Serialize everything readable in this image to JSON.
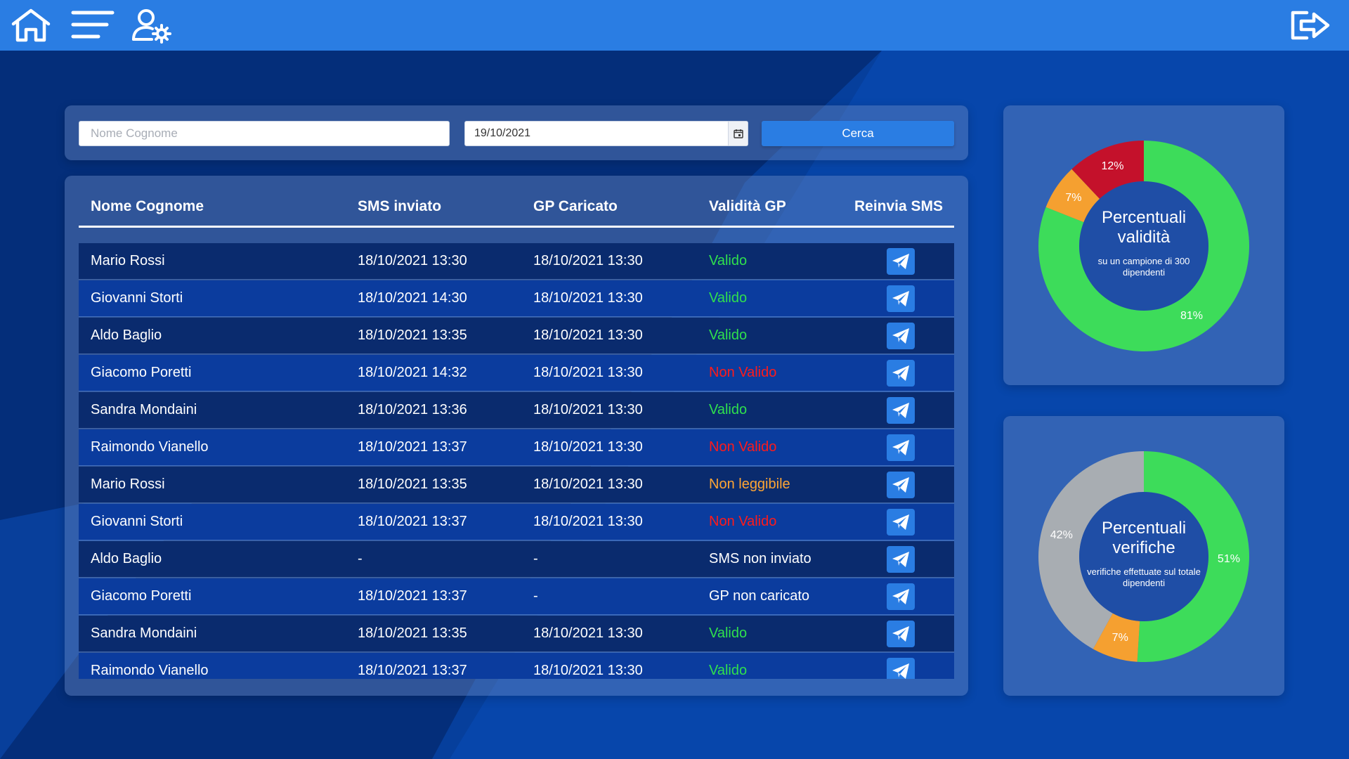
{
  "colors": {
    "topbar": "#2a7de3",
    "valid": "#2fe04d",
    "invalid": "#ff1a1a",
    "unreadable": "#ffa534",
    "chart_green": "#3ddc5a",
    "chart_orange": "#f5a030",
    "chart_red": "#c4112b",
    "chart_gray": "#a8adb2",
    "chart_inner": "#1f4ea6"
  },
  "topbar": {
    "icons": [
      "home-icon",
      "menu-icon",
      "user-settings-icon",
      "logout-icon"
    ]
  },
  "search": {
    "name_placeholder": "Nome Cognome",
    "name_value": "",
    "date_value": "19/10/2021",
    "button_label": "Cerca"
  },
  "table": {
    "headers": {
      "name": "Nome Cognome",
      "sms": "SMS inviato",
      "gp": "GP Caricato",
      "validity": "Validità GP",
      "resend": "Reinvia SMS"
    },
    "rows": [
      {
        "name": "Mario Rossi",
        "sms": "18/10/2021 13:30",
        "gp": "18/10/2021 13:30",
        "validity": "Valido",
        "status": "valid"
      },
      {
        "name": "Giovanni Storti",
        "sms": "18/10/2021 14:30",
        "gp": "18/10/2021 13:30",
        "validity": "Valido",
        "status": "valid"
      },
      {
        "name": "Aldo Baglio",
        "sms": "18/10/2021 13:35",
        "gp": "18/10/2021 13:30",
        "validity": "Valido",
        "status": "valid"
      },
      {
        "name": "Giacomo Poretti",
        "sms": "18/10/2021 14:32",
        "gp": "18/10/2021 13:30",
        "validity": "Non Valido",
        "status": "invalid"
      },
      {
        "name": "Sandra Mondaini",
        "sms": "18/10/2021 13:36",
        "gp": "18/10/2021 13:30",
        "validity": "Valido",
        "status": "valid"
      },
      {
        "name": "Raimondo Vianello",
        "sms": "18/10/2021 13:37",
        "gp": "18/10/2021 13:30",
        "validity": "Non Valido",
        "status": "invalid"
      },
      {
        "name": "Mario Rossi",
        "sms": "18/10/2021 13:35",
        "gp": "18/10/2021 13:30",
        "validity": "Non leggibile",
        "status": "unreadable"
      },
      {
        "name": "Giovanni Storti",
        "sms": "18/10/2021 13:37",
        "gp": "18/10/2021 13:30",
        "validity": "Non Valido",
        "status": "invalid"
      },
      {
        "name": "Aldo Baglio",
        "sms": "-",
        "gp": "-",
        "validity": "SMS non inviato",
        "status": "neutral"
      },
      {
        "name": "Giacomo Poretti",
        "sms": "18/10/2021 13:37",
        "gp": "-",
        "validity": "GP non caricato",
        "status": "neutral"
      },
      {
        "name": "Sandra Mondaini",
        "sms": "18/10/2021 13:35",
        "gp": "18/10/2021 13:30",
        "validity": "Valido",
        "status": "valid"
      },
      {
        "name": "Raimondo Vianello",
        "sms": "18/10/2021 13:37",
        "gp": "18/10/2021 13:30",
        "validity": "Valido",
        "status": "valid"
      }
    ]
  },
  "chart_data": [
    {
      "type": "pie",
      "title": "Percentuali validità",
      "subtitle": "su un campione di 300 dipendenti",
      "slices": [
        {
          "value": 81,
          "label": "81%",
          "color": "#3ddc5a"
        },
        {
          "value": 7,
          "label": "7%",
          "color": "#f5a030"
        },
        {
          "value": 12,
          "label": "12%",
          "color": "#c4112b"
        }
      ]
    },
    {
      "type": "pie",
      "title": "Percentuali verifiche",
      "subtitle": "verifiche effettuate sul totale dipendenti",
      "slices": [
        {
          "value": 51,
          "label": "51%",
          "color": "#3ddc5a"
        },
        {
          "value": 7,
          "label": "7%",
          "color": "#f5a030"
        },
        {
          "value": 42,
          "label": "42%",
          "color": "#a8adb2"
        }
      ]
    }
  ]
}
